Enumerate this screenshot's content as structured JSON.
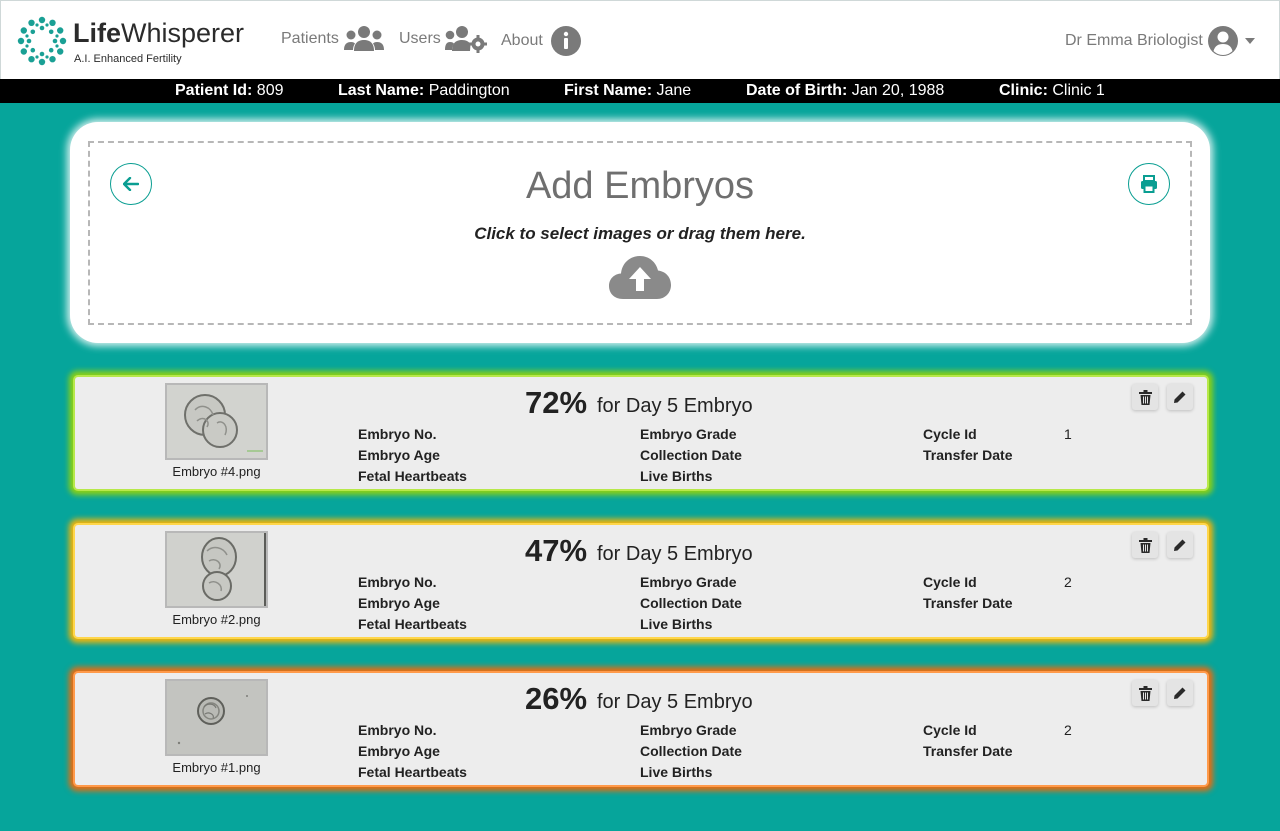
{
  "brand": {
    "name_bold": "Life",
    "name_rest": "Whisperer",
    "tagline": "A.I. Enhanced Fertility",
    "color": "#1aa095"
  },
  "nav": {
    "patients": "Patients",
    "users": "Users",
    "about": "About"
  },
  "user": {
    "name": "Dr Emma Briologist"
  },
  "patient": {
    "id_label": "Patient Id:",
    "id_value": "809",
    "last_name_label": "Last Name:",
    "last_name_value": "Paddington",
    "first_name_label": "First Name:",
    "first_name_value": "Jane",
    "dob_label": "Date of Birth:",
    "dob_value": "Jan 20, 1988",
    "clinic_label": "Clinic:",
    "clinic_value": "Clinic 1"
  },
  "upload": {
    "title": "Add Embryos",
    "hint": "Click to select images or drag them here."
  },
  "field_labels": {
    "embryo_no": "Embryo No.",
    "embryo_age": "Embryo Age",
    "fetal_heartbeats": "Fetal Heartbeats",
    "embryo_grade": "Embryo Grade",
    "collection_date": "Collection Date",
    "live_births": "Live Births",
    "cycle_id": "Cycle Id",
    "transfer_date": "Transfer Date"
  },
  "embryos": [
    {
      "image_name": "Embryo #4.png",
      "score": "72%",
      "score_label": "for Day 5 Embryo",
      "cycle_id": "1",
      "glow_color": "#8ed113"
    },
    {
      "image_name": "Embryo #2.png",
      "score": "47%",
      "score_label": "for Day 5 Embryo",
      "cycle_id": "2",
      "glow_color": "#f4b40a"
    },
    {
      "image_name": "Embryo #1.png",
      "score": "26%",
      "score_label": "for Day 5 Embryo",
      "cycle_id": "2",
      "glow_color": "#ee6b0e"
    }
  ],
  "icons": {
    "patients": "users-icon",
    "users": "users-cog-icon",
    "about": "info-circle-icon",
    "avatar": "user-circle-icon",
    "back": "arrow-left-icon",
    "print": "print-icon",
    "upload": "cloud-upload-icon",
    "delete": "trash-icon",
    "edit": "pencil-icon"
  }
}
